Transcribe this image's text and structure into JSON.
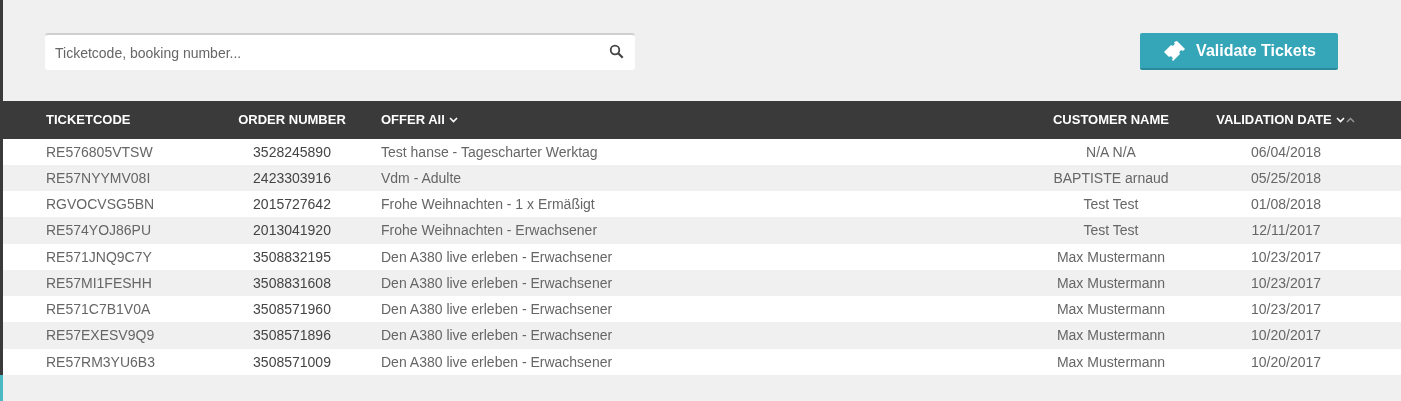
{
  "search": {
    "placeholder": "Ticketcode, booking number..."
  },
  "validate_button": {
    "label": "Validate Tickets"
  },
  "table": {
    "columns": [
      {
        "label": "TICKETCODE",
        "kind": "plain"
      },
      {
        "label": "ORDER NUMBER",
        "kind": "plain"
      },
      {
        "label": "OFFER All",
        "kind": "filter"
      },
      {
        "label": "CUSTOMER NAME",
        "kind": "plain"
      },
      {
        "label": "VALIDATION DATE",
        "kind": "sort"
      }
    ],
    "rows": [
      [
        "RE576805VTSW",
        "3528245890",
        "Test hanse - Tagescharter Werktag",
        "N/A N/A",
        "06/04/2018"
      ],
      [
        "RE57NYYMV08I",
        "2423303916",
        "Vdm - Adulte",
        "BAPTISTE arnaud",
        "05/25/2018"
      ],
      [
        "RGVOCVSG5BN",
        "2015727642",
        "Frohe Weihnachten - 1 x Ermäßigt",
        "Test Test",
        "01/08/2018"
      ],
      [
        "RE574YOJ86PU",
        "2013041920",
        "Frohe Weihnachten - Erwachsener",
        "Test Test",
        "12/11/2017"
      ],
      [
        "RE571JNQ9C7Y",
        "3508832195",
        "Den A380 live erleben - Erwachsener",
        "Max Mustermann",
        "10/23/2017"
      ],
      [
        "RE57MI1FESHH",
        "3508831608",
        "Den A380 live erleben - Erwachsener",
        "Max Mustermann",
        "10/23/2017"
      ],
      [
        "RE571C7B1V0A",
        "3508571960",
        "Den A380 live erleben - Erwachsener",
        "Max Mustermann",
        "10/23/2017"
      ],
      [
        "RE57EXESV9Q9",
        "3508571896",
        "Den A380 live erleben - Erwachsener",
        "Max Mustermann",
        "10/20/2017"
      ],
      [
        "RE57RM3YU6B3",
        "3508571009",
        "Den A380 live erleben - Erwachsener",
        "Max Mustermann",
        "10/20/2017"
      ]
    ]
  }
}
